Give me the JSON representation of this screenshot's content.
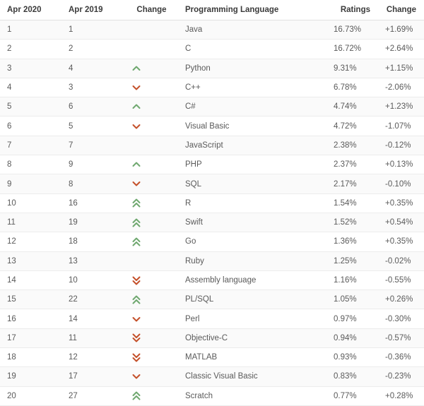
{
  "table": {
    "headers": {
      "rank_new": "Apr 2020",
      "rank_old": "Apr 2019",
      "change_icon": "Change",
      "language": "Programming Language",
      "ratings": "Ratings",
      "delta": "Change"
    },
    "colors": {
      "up": "#6fa86f",
      "down": "#c4502a",
      "text": "#5a5a5a",
      "header_text": "#3b3b3b",
      "row_stripe": "#fafafa",
      "row_plain": "#ffffff",
      "border": "#ececec"
    },
    "rows": [
      {
        "rank_new": "1",
        "rank_old": "1",
        "trend": "none",
        "language": "Java",
        "ratings": "16.73%",
        "delta": "+1.69%"
      },
      {
        "rank_new": "2",
        "rank_old": "2",
        "trend": "none",
        "language": "C",
        "ratings": "16.72%",
        "delta": "+2.64%"
      },
      {
        "rank_new": "3",
        "rank_old": "4",
        "trend": "up",
        "language": "Python",
        "ratings": "9.31%",
        "delta": "+1.15%"
      },
      {
        "rank_new": "4",
        "rank_old": "3",
        "trend": "down",
        "language": "C++",
        "ratings": "6.78%",
        "delta": "-2.06%"
      },
      {
        "rank_new": "5",
        "rank_old": "6",
        "trend": "up",
        "language": "C#",
        "ratings": "4.74%",
        "delta": "+1.23%"
      },
      {
        "rank_new": "6",
        "rank_old": "5",
        "trend": "down",
        "language": "Visual Basic",
        "ratings": "4.72%",
        "delta": "-1.07%"
      },
      {
        "rank_new": "7",
        "rank_old": "7",
        "trend": "none",
        "language": "JavaScript",
        "ratings": "2.38%",
        "delta": "-0.12%"
      },
      {
        "rank_new": "8",
        "rank_old": "9",
        "trend": "up",
        "language": "PHP",
        "ratings": "2.37%",
        "delta": "+0.13%"
      },
      {
        "rank_new": "9",
        "rank_old": "8",
        "trend": "down",
        "language": "SQL",
        "ratings": "2.17%",
        "delta": "-0.10%"
      },
      {
        "rank_new": "10",
        "rank_old": "16",
        "trend": "up-double",
        "language": "R",
        "ratings": "1.54%",
        "delta": "+0.35%"
      },
      {
        "rank_new": "11",
        "rank_old": "19",
        "trend": "up-double",
        "language": "Swift",
        "ratings": "1.52%",
        "delta": "+0.54%"
      },
      {
        "rank_new": "12",
        "rank_old": "18",
        "trend": "up-double",
        "language": "Go",
        "ratings": "1.36%",
        "delta": "+0.35%"
      },
      {
        "rank_new": "13",
        "rank_old": "13",
        "trend": "none",
        "language": "Ruby",
        "ratings": "1.25%",
        "delta": "-0.02%"
      },
      {
        "rank_new": "14",
        "rank_old": "10",
        "trend": "down-double",
        "language": "Assembly language",
        "ratings": "1.16%",
        "delta": "-0.55%"
      },
      {
        "rank_new": "15",
        "rank_old": "22",
        "trend": "up-double",
        "language": "PL/SQL",
        "ratings": "1.05%",
        "delta": "+0.26%"
      },
      {
        "rank_new": "16",
        "rank_old": "14",
        "trend": "down",
        "language": "Perl",
        "ratings": "0.97%",
        "delta": "-0.30%"
      },
      {
        "rank_new": "17",
        "rank_old": "11",
        "trend": "down-double",
        "language": "Objective-C",
        "ratings": "0.94%",
        "delta": "-0.57%"
      },
      {
        "rank_new": "18",
        "rank_old": "12",
        "trend": "down-double",
        "language": "MATLAB",
        "ratings": "0.93%",
        "delta": "-0.36%"
      },
      {
        "rank_new": "19",
        "rank_old": "17",
        "trend": "down",
        "language": "Classic Visual Basic",
        "ratings": "0.83%",
        "delta": "-0.23%"
      },
      {
        "rank_new": "20",
        "rank_old": "27",
        "trend": "up-double",
        "language": "Scratch",
        "ratings": "0.77%",
        "delta": "+0.28%"
      }
    ]
  },
  "icon_names": {
    "none": "no-change-icon",
    "up": "chevron-up-icon",
    "down": "chevron-down-icon",
    "up-double": "chevron-double-up-icon",
    "down-double": "chevron-double-down-icon"
  }
}
